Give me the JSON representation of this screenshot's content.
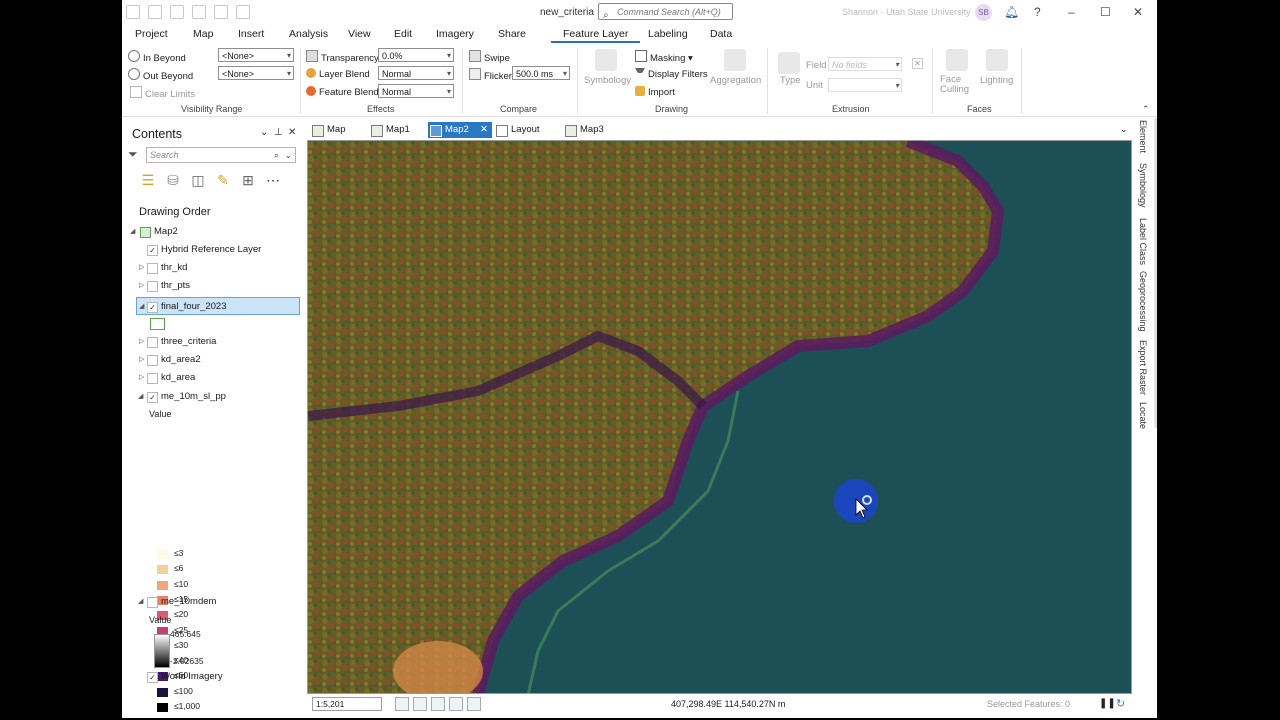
{
  "window": {
    "doc_title": "new_criteria",
    "command_search_placeholder": "Command Search (Alt+Q)",
    "user_name": "Shannon - Utah State University",
    "user_initials": "SB",
    "help_label": "?",
    "minimize_label": "–",
    "maximize_label": "☐",
    "close_label": "✕"
  },
  "ribbon_tabs": [
    "Project",
    "Map",
    "Insert",
    "Analysis",
    "View",
    "Edit",
    "Imagery",
    "Share",
    "Feature Layer",
    "Labeling",
    "Data"
  ],
  "ribbon": {
    "visibility": {
      "group": "Visibility Range",
      "in_beyond": "In Beyond",
      "out_beyond": "Out Beyond",
      "clear_limits": "Clear Limits",
      "in_value": "<None>",
      "out_value": "<None>"
    },
    "effects": {
      "group": "Effects",
      "transparency_label": "Transparency",
      "transparency_value": "0.0%",
      "layer_blend_label": "Layer Blend",
      "layer_blend_value": "Normal",
      "feature_blend_label": "Feature Blend",
      "feature_blend_value": "Normal"
    },
    "compare": {
      "group": "Compare",
      "swipe": "Swipe",
      "flicker": "Flicker",
      "flicker_value": "500.0",
      "flicker_unit": "ms"
    },
    "drawing": {
      "group": "Drawing",
      "symbology": "Symbology",
      "masking": "Masking",
      "display_filters": "Display Filters",
      "import": "Import",
      "aggregation": "Aggregation"
    },
    "extrusion": {
      "group": "Extrusion",
      "type": "Type",
      "field": "Field",
      "field_value": "No fields",
      "unit": "Unit"
    },
    "faces": {
      "group": "Faces",
      "face_culling": "Face Culling",
      "lighting": "Lighting"
    }
  },
  "contents": {
    "title": "Contents",
    "search_placeholder": "Search",
    "drawing_order": "Drawing Order",
    "layers": {
      "map": "Map2",
      "hybrid": "Hybrid Reference Layer",
      "thr_kd": "thr_kd",
      "thr_pts": "thr_pts",
      "final_four": "final_four_2023",
      "three_criteria": "three_criteria",
      "kd_area2": "kd_area2",
      "kd_area": "kd_area",
      "me_10m": "me_10m_sl_pp",
      "value_label": "Value",
      "me_10mdem": "me_10mdem",
      "dem_value_label": "Value",
      "dem_max": "465.645",
      "dem_min": "-2.02635",
      "world_imagery": "World Imagery"
    },
    "legend": [
      {
        "label": "≤3",
        "color": "#fff9e6"
      },
      {
        "label": "≤6",
        "color": "#f7cf9a"
      },
      {
        "label": "≤10",
        "color": "#f2a57a"
      },
      {
        "label": "≤15",
        "color": "#ea7f6c"
      },
      {
        "label": "≤20",
        "color": "#d95a72"
      },
      {
        "label": "≤25",
        "color": "#bd4177"
      },
      {
        "label": "≤30",
        "color": "#98307a"
      },
      {
        "label": "≤40",
        "color": "#6f2478"
      },
      {
        "label": "≤60",
        "color": "#43196a"
      },
      {
        "label": "≤100",
        "color": "#1b0f3d"
      },
      {
        "label": "≤1,000",
        "color": "#000000"
      }
    ]
  },
  "map_tabs": [
    "Map",
    "Map1",
    "Map2",
    "Layout",
    "Map3"
  ],
  "active_map_tab": "Map2",
  "side_tabs": [
    "Element",
    "Symbology",
    "Label Class",
    "Geoprocessing",
    "Export Raster",
    "Locate"
  ],
  "status": {
    "scale": "1:5,201",
    "coords": "407,298.49E 114,540.27N m",
    "selected_features": "Selected Features: 0"
  },
  "colors": {
    "accent": "#2c6fbd",
    "water": "#1d4f57",
    "cursor_ring": "#1c45c8"
  }
}
